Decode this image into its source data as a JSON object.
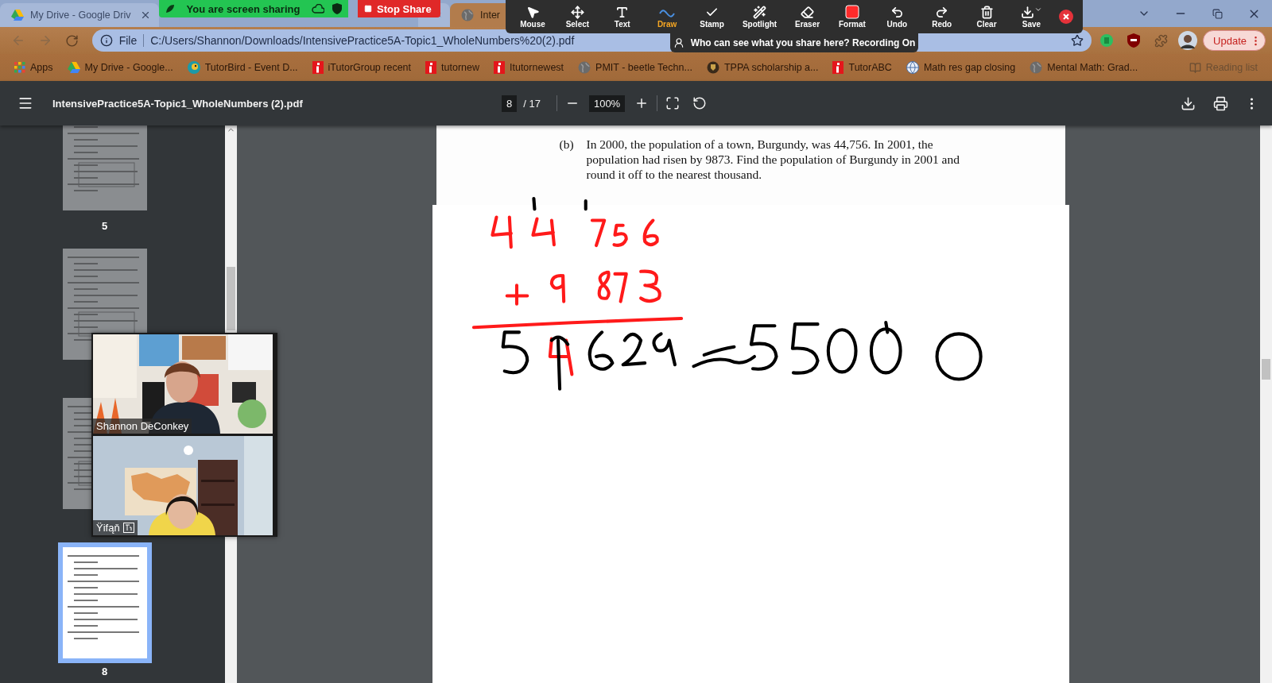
{
  "browser": {
    "tabs": [
      {
        "title": "My Drive - Google Driv",
        "selected": false,
        "kind": "drive"
      },
      {
        "selected": false,
        "kind": "hidden"
      },
      {
        "title": "Inter",
        "selected": true,
        "kind": "globe"
      }
    ],
    "address_bar": {
      "scheme": "File",
      "url": "C:/Users/Shannon/Downloads/IntensivePractice5A-Topic1_WholeNumbers%20(2).pdf"
    },
    "update_button": "Update",
    "bookmarks": [
      {
        "title": "Apps",
        "kind": "apps"
      },
      {
        "title": "My Drive - Google...",
        "kind": "drive"
      },
      {
        "title": "TutorBird - Event D...",
        "kind": "bird"
      },
      {
        "title": "iTutorGroup recent",
        "kind": "itutor"
      },
      {
        "title": "tutornew",
        "kind": "itutor"
      },
      {
        "title": "Itutornewest",
        "kind": "itutor"
      },
      {
        "title": "PMIT - beetle Techn...",
        "kind": "globe"
      },
      {
        "title": "TPPA scholarship a...",
        "kind": "crest"
      },
      {
        "title": "TutorABC",
        "kind": "itutor"
      },
      {
        "title": "Math res gap closing",
        "kind": "earth"
      },
      {
        "title": "Mental Math: Grad...",
        "kind": "globe"
      }
    ],
    "reading_list": "Reading list"
  },
  "share_bar": {
    "status": "You are screen sharing",
    "stop": "Stop Share"
  },
  "annotate_toolbar": {
    "tools": [
      {
        "label": "Mouse",
        "kind": "mouse",
        "selected": false
      },
      {
        "label": "Select",
        "kind": "select",
        "selected": false
      },
      {
        "label": "Text",
        "kind": "text",
        "selected": false
      },
      {
        "label": "Draw",
        "kind": "draw",
        "selected": true
      },
      {
        "label": "Stamp",
        "kind": "stamp",
        "selected": false
      },
      {
        "label": "Spotlight",
        "kind": "spotlight",
        "selected": false
      },
      {
        "label": "Eraser",
        "kind": "eraser",
        "selected": false
      },
      {
        "label": "Format",
        "kind": "format",
        "selected": false
      },
      {
        "label": "Undo",
        "kind": "undo",
        "selected": false
      },
      {
        "label": "Redo",
        "kind": "redo",
        "selected": false
      },
      {
        "label": "Clear",
        "kind": "clear",
        "selected": false
      },
      {
        "label": "Save",
        "kind": "save",
        "selected": false
      }
    ],
    "notice": "Who can see what you share here? Recording On"
  },
  "pdf_viewer": {
    "title": "IntensivePractice5A-Topic1_WholeNumbers (2).pdf",
    "page": "8",
    "page_count": "/ 17",
    "zoom": "100%",
    "thumbnails": [
      {
        "number": "5",
        "selected": false
      },
      {
        "selected": false
      },
      {
        "selected": false
      },
      {
        "number": "8",
        "selected": true
      }
    ],
    "question": {
      "label": "(b)",
      "text": "In 2000, the population of a town, Burgundy, was 44,756. In 2001, the population had risen by 9873. Find the population of Burgundy in 2001 and round it off to the nearest thousand."
    }
  },
  "video": [
    {
      "name": "Shannon DeConkey",
      "kind": "office"
    },
    {
      "name": "Ÿifąň",
      "kind": "bedroom",
      "captions": true
    }
  ]
}
